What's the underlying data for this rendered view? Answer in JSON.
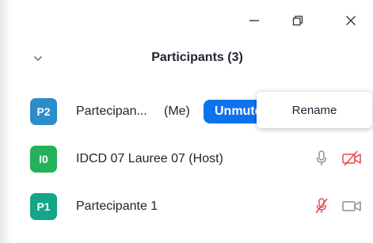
{
  "window": {
    "minimize_icon": "minimize-icon",
    "restore_icon": "restore-icon",
    "close_icon": "close-icon"
  },
  "panel": {
    "title": "Participants (3)",
    "collapse_icon": "chevron-down-icon"
  },
  "participants": [
    {
      "initials": "P2",
      "name": "Partecipan...",
      "tag": "(Me)",
      "avatar_color": "#2d8cca",
      "action_label": "Unmute"
    },
    {
      "initials": "I0",
      "name": "IDCD 07 Lauree 07 (Host)",
      "avatar_color": "#23b25b",
      "mic": "mic-on-icon",
      "video": "video-off-icon"
    },
    {
      "initials": "P1",
      "name": "Partecipante 1",
      "avatar_color": "#13a688",
      "mic": "mic-muted-icon",
      "video": "video-on-icon"
    }
  ],
  "context_menu": {
    "items": [
      "Rename"
    ]
  },
  "colors": {
    "accent": "#0e72ed",
    "muted_red": "#e8474a",
    "icon_gray": "#8c8c95"
  }
}
